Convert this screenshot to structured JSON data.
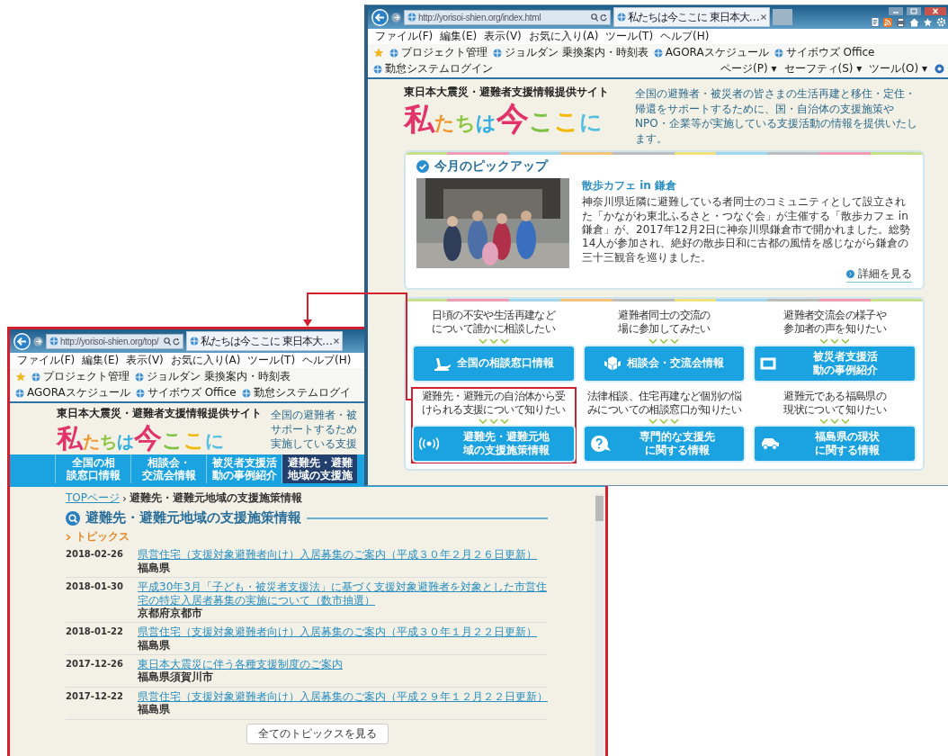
{
  "home_window": {
    "highlighted": false,
    "address": "http://yorisoi-shien.org/index.html",
    "tab_title": "私たちは今ここに 東日本大…",
    "menu": [
      "ファイル(F)",
      "編集(E)",
      "表示(V)",
      "お気に入り(A)",
      "ツール(T)",
      "ヘルプ(H)"
    ],
    "commands": [
      "ページ(P) ▾",
      "セーフティ(S) ▾",
      "ツール(O) ▾"
    ],
    "favorites": [
      "プロジェクト管理",
      "ジョルダン 乗換案内・時刻表",
      "AGORAスケジュール",
      "サイボウズ Office",
      "勤怠システムログイン"
    ],
    "page": {
      "site_subtitle": "東日本大震災・避難者支援情報提供サイト",
      "logo": "私たちは今ここに",
      "tagline": "全国の避難者・被災者の皆さまの生活再建と移住・定住・帰還をサポートするために、国・自治体の支援施策やNPO・企業等が実施している支援活動の情報を提供いたします。",
      "pickup": {
        "heading": "今月のピックアップ",
        "title": "散歩カフェ in 鎌倉",
        "body": "神奈川県近隣に避難している者同士のコミュニティとして設立された「かながわ東北ふるさと・つなぐ会」が主催する「散歩カフェ in 鎌倉」が、2017年12月2日に神奈川県鎌倉市で開かれました。総勢14人が参加され、絶好の散歩日和に古都の風情を感じながら鎌倉の三十三観音を巡りました。",
        "more_link": "詳細を見る"
      },
      "guides": [
        {
          "question": "日頃の不安や生活再建などについて誰かに相談したい",
          "button": "全国の相談窓口情報",
          "highlighted": false
        },
        {
          "question": "避難者同士の交流の場に参加してみたい",
          "button": "相談会・交流会情報",
          "highlighted": false
        },
        {
          "question": "避難者交流会の様子や参加者の声を知りたい",
          "button": "被災者支援活動の事例紹介",
          "highlighted": false
        },
        {
          "question": "避難先・避難元の自治体から受けられる支援について知りたい",
          "button": "避難先・避難元地域の支援施策情報",
          "highlighted": true
        },
        {
          "question": "法律相談、住宅再建など個別の悩みについての相談窓口が知りたい",
          "button": "専門的な支援先に関する情報",
          "highlighted": false
        },
        {
          "question": "避難元である福島県の現状について知りたい",
          "button": "福島県の現状に関する情報",
          "highlighted": false
        }
      ]
    }
  },
  "topics_window": {
    "highlighted": true,
    "address": "http://yorisoi-shien.org/top/",
    "tab_title": "私たちは今ここに 東日本大…",
    "menu": [
      "ファイル(F)",
      "編集(E)",
      "表示(V)",
      "お気に入り(A)",
      "ツール(T)",
      "ヘルプ(H)"
    ],
    "favorites": [
      "プロジェクト管理",
      "ジョルダン 乗換案内・時刻表",
      "AGORAスケジュール",
      "サイボウズ Office",
      "勤怠システムログイ"
    ],
    "page": {
      "site_subtitle": "東日本大震災・避難者支援情報提供サイト",
      "logo": "私たちは今ここに",
      "tagline_lines": [
        "全国の避難者・被",
        "サポートするため",
        "実施している支援"
      ],
      "nav": [
        {
          "label": "全国の相談窓口情報",
          "selected": false
        },
        {
          "label": "相談会・交流会情報",
          "selected": false
        },
        {
          "label": "被災者支援活動の事例紹介",
          "selected": false
        },
        {
          "label": "避難先・避難地域の支援施",
          "selected": true
        }
      ],
      "breadcrumb": {
        "link": "TOPページ",
        "separator": "›",
        "current": "避難先・避難元地域の支援施策情報"
      },
      "heading": "避難先・避難元地域の支援施策情報",
      "section": "トピックス",
      "topics": [
        {
          "date": "2018-02-26",
          "title": "県営住宅（支援対象避難者向け）入居募集のご案内（平成３０年２月２６日更新）",
          "place": "福島県"
        },
        {
          "date": "2018-01-30",
          "title": "平成30年3月「子ども・被災者支援法」に基づく支援対象避難者を対象とした市営住宅の特定入居者募集の実施について（数市抽選）",
          "place": "京都府京都市"
        },
        {
          "date": "2018-01-22",
          "title": "県営住宅（支援対象避難者向け）入居募集のご案内（平成３０年１月２２日更新）",
          "place": "福島県"
        },
        {
          "date": "2017-12-26",
          "title": "東日本大震災に伴う各種支援制度のご案内",
          "place": "福島県須賀川市"
        },
        {
          "date": "2017-12-22",
          "title": "県営住宅（支援対象避難者向け）入居募集のご案内（平成２９年１２月２２日更新）",
          "place": "福島県"
        }
      ],
      "all_button": "全てのトピックスを見る"
    }
  }
}
